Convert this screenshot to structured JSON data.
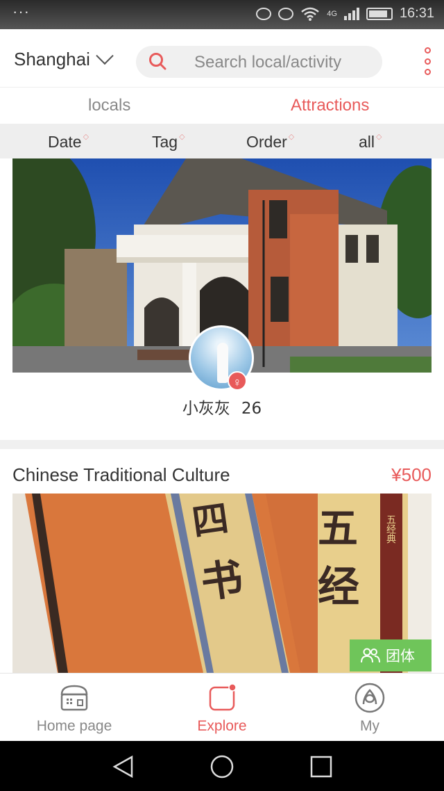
{
  "status_bar": {
    "time": "16:31",
    "network": "4G",
    "left_dots": "···"
  },
  "header": {
    "city": "Shanghai",
    "search_placeholder": "Search local/activity"
  },
  "tabs": [
    {
      "label": "locals",
      "active": false
    },
    {
      "label": "Attractions",
      "active": true
    }
  ],
  "filters": [
    {
      "label": "Date"
    },
    {
      "label": "Tag"
    },
    {
      "label": "Order"
    },
    {
      "label": "all"
    }
  ],
  "cards": [
    {
      "author_name": "小灰灰",
      "author_age": "26"
    },
    {
      "title": "Chinese Traditional Culture",
      "price": "¥500",
      "badge": "团体",
      "image_text": [
        "四",
        "书",
        "五",
        "经",
        "五经典"
      ]
    }
  ],
  "bottom_nav": [
    {
      "label": "Home page",
      "active": false
    },
    {
      "label": "Explore",
      "active": true
    },
    {
      "label": "My",
      "active": false
    }
  ],
  "colors": {
    "accent": "#e85a5a",
    "group_badge": "#6fc55a",
    "filter_bg": "#eeeeee"
  }
}
